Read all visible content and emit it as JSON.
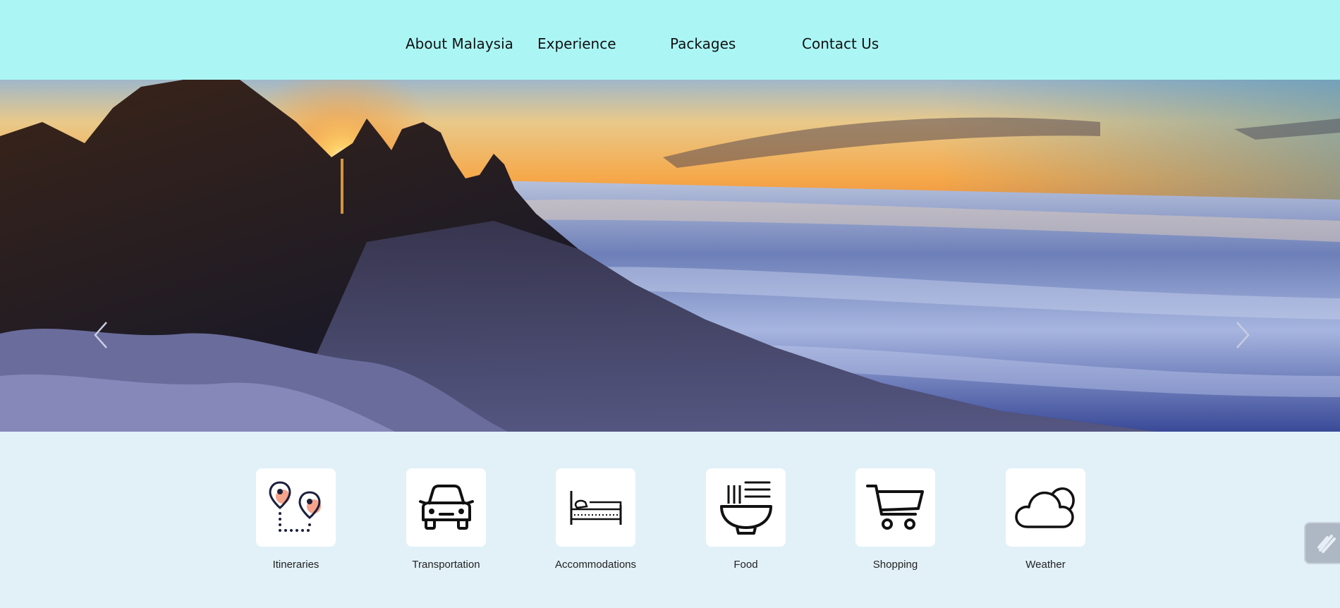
{
  "nav": {
    "items": [
      {
        "label": "About Malaysia"
      },
      {
        "label": "Experience"
      },
      {
        "label": "Packages"
      },
      {
        "label": "Contact Us"
      }
    ]
  },
  "hero": {
    "prev_icon": "chevron-left-icon",
    "next_icon": "chevron-right-icon"
  },
  "categories": [
    {
      "label": "Itineraries",
      "icon": "map-route-icon"
    },
    {
      "label": "Transportation",
      "icon": "car-icon"
    },
    {
      "label": "Accommodations",
      "icon": "bed-icon"
    },
    {
      "label": "Food",
      "icon": "noodle-bowl-icon"
    },
    {
      "label": "Shopping",
      "icon": "shopping-cart-icon"
    },
    {
      "label": "Weather",
      "icon": "cloud-sun-icon"
    }
  ],
  "colors": {
    "header_bg": "#abf6f5",
    "page_bg": "#e2f1f8",
    "pin_accent": "#f5a38a",
    "icon_dark": "#1b1f3b"
  }
}
